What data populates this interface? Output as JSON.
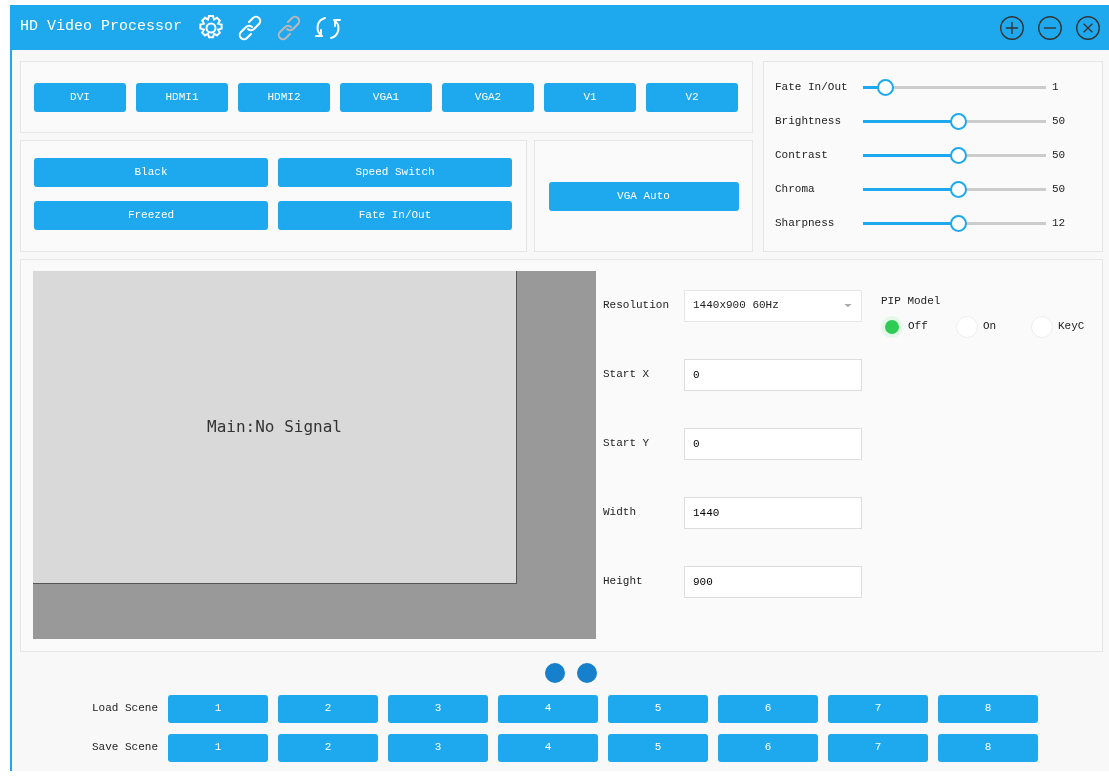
{
  "window": {
    "title": "HD Video Processor"
  },
  "toolbar": [
    {
      "kind": "settings",
      "disabled": false
    },
    {
      "kind": "link",
      "disabled": false
    },
    {
      "kind": "link",
      "disabled": true
    },
    {
      "kind": "refresh",
      "disabled": false
    }
  ],
  "window_controls": [
    {
      "kind": "add"
    },
    {
      "kind": "remove"
    },
    {
      "kind": "close"
    }
  ],
  "inputs": [
    "DVI",
    "HDMI1",
    "HDMI2",
    "VGA1",
    "VGA2",
    "V1",
    "V2"
  ],
  "functions": [
    "Black",
    "Speed Switch",
    "Freezed",
    "Fate In/Out"
  ],
  "vga_button": "VGA Auto",
  "sliders": [
    {
      "name": "Fate In/Out",
      "level": 0.12,
      "reading": "1"
    },
    {
      "name": "Brightness",
      "level": 0.52,
      "reading": "50"
    },
    {
      "name": "Contrast",
      "level": 0.52,
      "reading": "50"
    },
    {
      "name": "Chroma",
      "level": 0.52,
      "reading": "50"
    },
    {
      "name": "Sharpness",
      "level": 0.52,
      "reading": "12"
    }
  ],
  "preview": {
    "message": "Main:No Signal"
  },
  "form": {
    "resolution": {
      "label": "Resolution",
      "value": "1440x900 60Hz"
    },
    "fields": [
      {
        "label": "Start X",
        "value": "0"
      },
      {
        "label": "Start Y",
        "value": "0"
      },
      {
        "label": "Width",
        "value": "1440"
      },
      {
        "label": "Height",
        "value": "900"
      }
    ]
  },
  "pip": {
    "title": "PIP Model",
    "options": [
      {
        "label": "Off",
        "selected": true
      },
      {
        "label": "On",
        "selected": false
      },
      {
        "label": "KeyC",
        "selected": false
      }
    ]
  },
  "scenes": [
    {
      "label": "Load Scene",
      "buttons": [
        "1",
        "2",
        "3",
        "4",
        "5",
        "6",
        "7",
        "8"
      ]
    },
    {
      "label": "Save Scene",
      "buttons": [
        "1",
        "2",
        "3",
        "4",
        "5",
        "6",
        "7",
        "8"
      ]
    }
  ]
}
